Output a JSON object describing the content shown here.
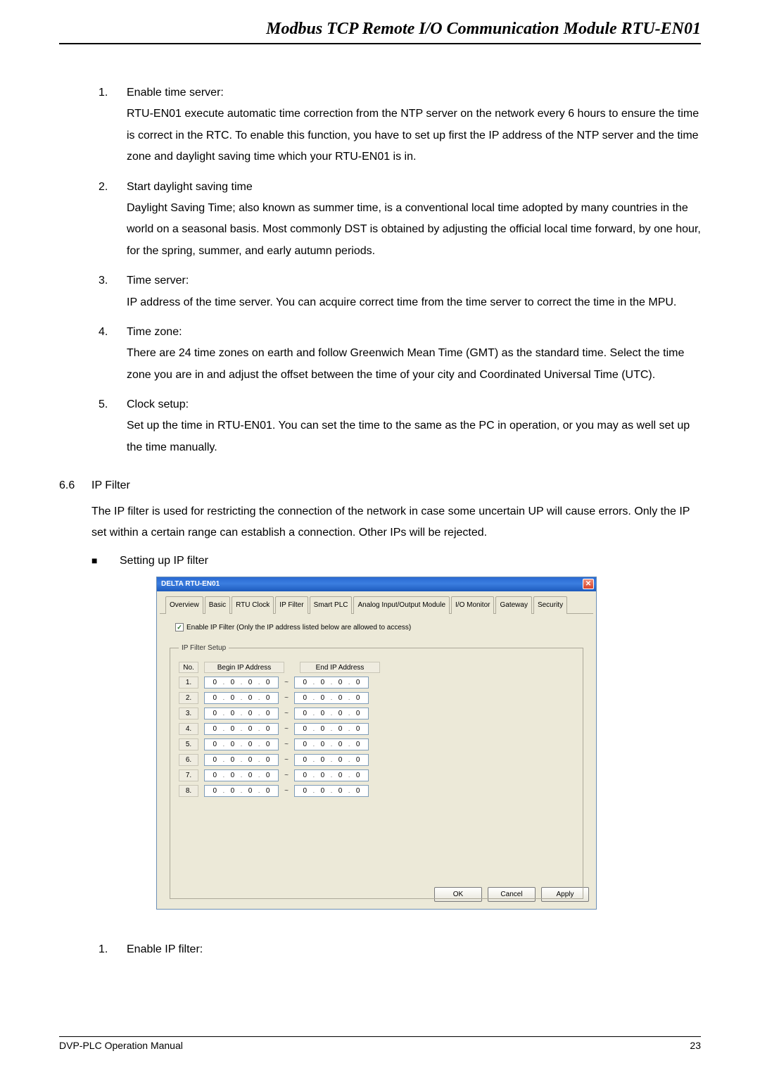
{
  "header": "Modbus TCP Remote I/O Communication Module RTU-EN01",
  "items": [
    {
      "num": "1.",
      "title": "Enable time server:",
      "body": "RTU-EN01 execute automatic time correction from the NTP server on the network every 6 hours to ensure the time is correct in the RTC. To enable this function, you have to set up first the IP address of the NTP server and the time zone and daylight saving time which your RTU-EN01 is in."
    },
    {
      "num": "2.",
      "title": "Start daylight saving time",
      "body": "Daylight Saving Time; also known as summer time, is a conventional local time adopted by many countries in the world on a seasonal basis. Most commonly DST is obtained by adjusting the official local time forward, by one hour, for the spring, summer, and early autumn periods."
    },
    {
      "num": "3.",
      "title": "Time server:",
      "body": "IP address of the time server. You can acquire correct time from the time server to correct the time in the MPU."
    },
    {
      "num": "4.",
      "title": "Time zone:",
      "body": "There are 24 time zones on earth and follow Greenwich Mean Time (GMT) as the standard time. Select the time zone you are in and adjust the offset between the time of your city and Coordinated Universal Time (UTC)."
    },
    {
      "num": "5.",
      "title": "Clock setup:",
      "body": "Set up the time in RTU-EN01. You can set the time to the same as the PC in operation, or you may as well set up the time manually."
    }
  ],
  "section": {
    "num": "6.6",
    "title": "IP Filter",
    "body": "The IP filter is used for restricting the connection of the network in case some uncertain UP will cause errors. Only the IP set within a certain range can establish a connection. Other IPs will be rejected.",
    "bullet": "Setting up IP filter"
  },
  "dialog": {
    "title": "DELTA RTU-EN01",
    "tabs": [
      "Overview",
      "Basic",
      "RTU Clock",
      "IP Filter",
      "Smart PLC",
      "Analog Input/Output Module",
      "I/O Monitor",
      "Gateway",
      "Security"
    ],
    "active_tab": 3,
    "checkbox_label": "Enable IP Filter  (Only the IP address listed below are allowed to access)",
    "checkbox_checked": true,
    "fieldset_legend": "IP Filter Setup",
    "col_no": "No.",
    "col_begin": "Begin IP Address",
    "col_end": "End IP Address",
    "rows": [
      {
        "n": "1.",
        "b": [
          "0",
          "0",
          "0",
          "0"
        ],
        "e": [
          "0",
          "0",
          "0",
          "0"
        ]
      },
      {
        "n": "2.",
        "b": [
          "0",
          "0",
          "0",
          "0"
        ],
        "e": [
          "0",
          "0",
          "0",
          "0"
        ]
      },
      {
        "n": "3.",
        "b": [
          "0",
          "0",
          "0",
          "0"
        ],
        "e": [
          "0",
          "0",
          "0",
          "0"
        ]
      },
      {
        "n": "4.",
        "b": [
          "0",
          "0",
          "0",
          "0"
        ],
        "e": [
          "0",
          "0",
          "0",
          "0"
        ]
      },
      {
        "n": "5.",
        "b": [
          "0",
          "0",
          "0",
          "0"
        ],
        "e": [
          "0",
          "0",
          "0",
          "0"
        ]
      },
      {
        "n": "6.",
        "b": [
          "0",
          "0",
          "0",
          "0"
        ],
        "e": [
          "0",
          "0",
          "0",
          "0"
        ]
      },
      {
        "n": "7.",
        "b": [
          "0",
          "0",
          "0",
          "0"
        ],
        "e": [
          "0",
          "0",
          "0",
          "0"
        ]
      },
      {
        "n": "8.",
        "b": [
          "0",
          "0",
          "0",
          "0"
        ],
        "e": [
          "0",
          "0",
          "0",
          "0"
        ]
      }
    ],
    "tilde": "~",
    "buttons": {
      "ok": "OK",
      "cancel": "Cancel",
      "apply": "Apply"
    }
  },
  "post_item": {
    "num": "1.",
    "title": "Enable IP filter:"
  },
  "footer": {
    "left": "DVP-PLC Operation Manual",
    "right": "23"
  }
}
